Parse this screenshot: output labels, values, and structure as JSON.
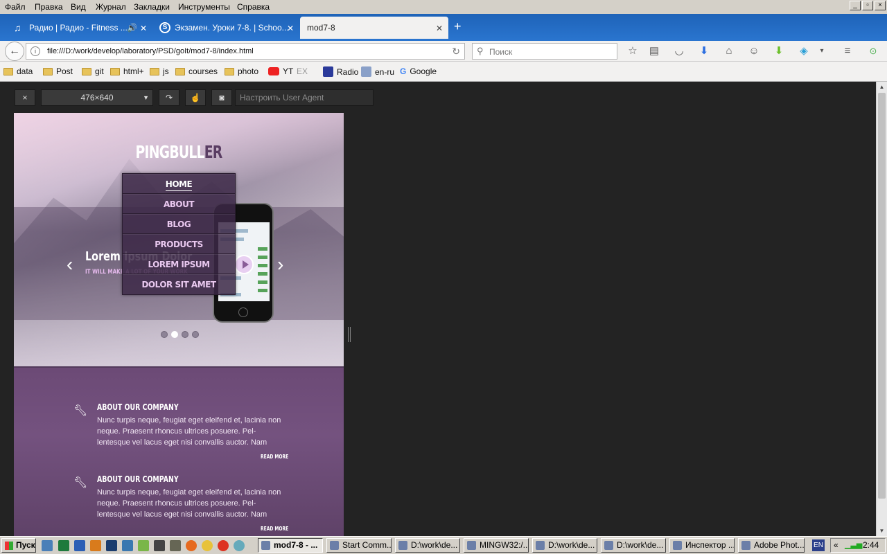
{
  "menubar": {
    "items": [
      "Файл",
      "Правка",
      "Вид",
      "Журнал",
      "Закладки",
      "Инструменты",
      "Справка"
    ]
  },
  "tabs": [
    {
      "label": "Радио | Радио - Fitness ...",
      "icon": "music-icon"
    },
    {
      "label": "Экзамен. Уроки 7-8. | Schoo...",
      "icon": "s-site-icon"
    },
    {
      "label": "mod7-8",
      "icon": "none"
    }
  ],
  "nav": {
    "url": "file:///D:/work/develop/laboratory/PSD/goIt/mod7-8/index.html",
    "search_placeholder": "Поиск"
  },
  "bookmarks": [
    {
      "label": "data",
      "type": "folder"
    },
    {
      "label": "Post",
      "type": "folder"
    },
    {
      "label": "git",
      "type": "folder"
    },
    {
      "label": "html+",
      "type": "folder"
    },
    {
      "label": "js",
      "type": "folder"
    },
    {
      "label": "courses",
      "type": "folder"
    },
    {
      "label": "photo",
      "type": "folder"
    },
    {
      "label": "YT",
      "type": "youtube"
    },
    {
      "label": "EX",
      "type": "ex"
    },
    {
      "label": "Radio",
      "type": "radio"
    },
    {
      "label": "en-ru",
      "type": "translate"
    },
    {
      "label": "Google",
      "type": "google"
    }
  ],
  "rdm": {
    "close": "×",
    "size": "476×640",
    "ua_placeholder": "Настроить User Agent"
  },
  "site": {
    "logo_main": "PINGBULL",
    "logo_accent": "ER",
    "menu": [
      "HOME",
      "ABOUT",
      "BLOG",
      "PRODUCTS",
      "LOREM IPSUM",
      "DOLOR SIT AMET"
    ],
    "slide_title": "Lorem Ipsum Dolor",
    "slide_sub": "IT WILL MAKE A LOT OF YOUR WORK",
    "slide_dots": 4,
    "slide_active": 2,
    "features": [
      {
        "title": "ABOUT OUR COMPANY",
        "text": "Nunc turpis neque, feugiat eget eleifend et, lacinia non neque. Praesent rhoncus ultrices posuere. Pel-lentesque vel lacus eget nisi convallis auctor. Nam",
        "more": "READ MORE"
      },
      {
        "title": "ABOUT OUR COMPANY",
        "text": "Nunc turpis neque, feugiat eget eleifend et, lacinia non neque. Praesent rhoncus ultrices posuere. Pel-lentesque vel lacus eget nisi convallis auctor. Nam",
        "more": "READ MORE"
      }
    ]
  },
  "taskbar": {
    "start": "Пуск",
    "tasks": [
      "mod7-8 - ...",
      "Start Comm...",
      "D:\\work\\de...",
      "MINGW32:/...",
      "D:\\work\\de...",
      "D:\\work\\de...",
      "Инспектор ...",
      "Adobe Phot..."
    ],
    "lang": "EN",
    "time": "2:44"
  },
  "colors": {
    "tab_bar": "#1e63b8",
    "site_purple": "#6c4a76",
    "menu_text": "#e9c8ef"
  }
}
